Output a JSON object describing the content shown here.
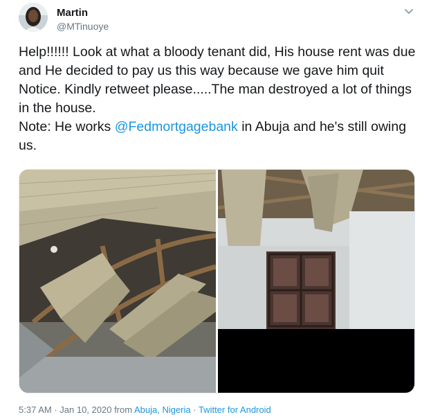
{
  "user": {
    "name": "Martin",
    "handle": "@MTinuoye"
  },
  "tweet": {
    "text_part1": "Help!!!!!! Look at what a bloody tenant did, His house rent was due and He decided to pay us this way because we gave him quit Notice. Kindly retweet please.....The man destroyed a lot of things in the house.",
    "text_part2": "Note: He works ",
    "mention": "@Fedmortgagebank",
    "text_part3": " in Abuja and he's still owing us."
  },
  "meta": {
    "time": "5:37 AM",
    "sep1": " · ",
    "date": "Jan 10, 2020",
    "from": " from ",
    "location": "Abuja, Nigeria",
    "sep2": " · ",
    "source": "Twitter for Android"
  },
  "icons": {
    "caret": "chevron-down-icon"
  }
}
